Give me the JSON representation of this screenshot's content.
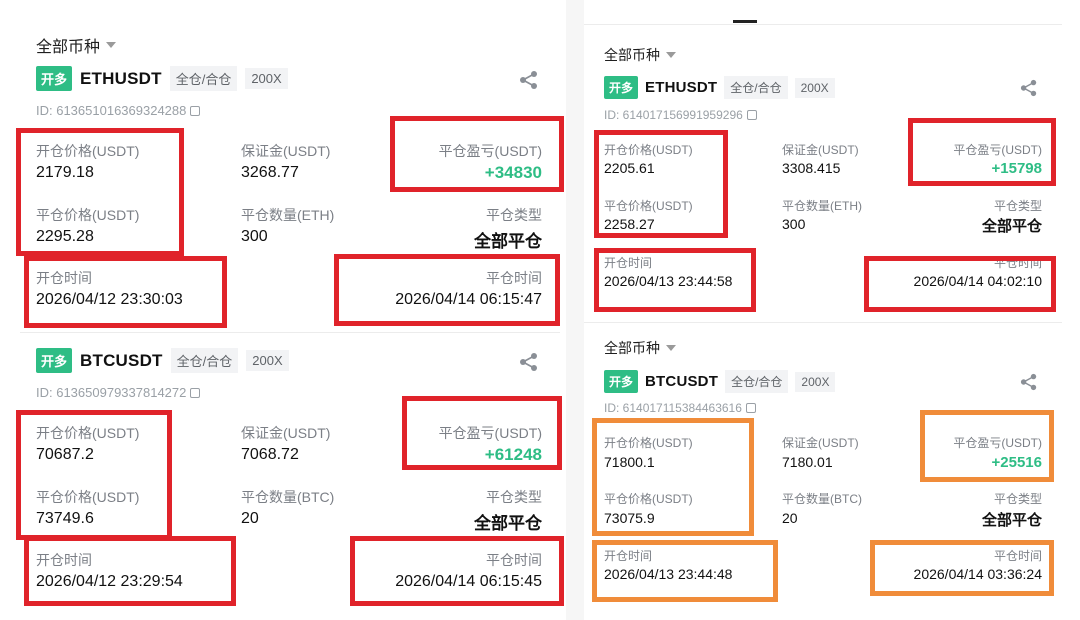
{
  "left": {
    "filter": "全部币种",
    "cards": [
      {
        "side": "开多",
        "symbol": "ETHUSDT",
        "margin_mode": "全仓/合仓",
        "leverage": "200X",
        "id": "ID: 613651016369324288",
        "open_price_label": "开仓价格(USDT)",
        "open_price": "2179.18",
        "margin_label": "保证金(USDT)",
        "margin": "3268.77",
        "pnl_label": "平仓盈亏(USDT)",
        "pnl": "+34830",
        "close_price_label": "平仓价格(USDT)",
        "close_price": "2295.28",
        "close_qty_label": "平仓数量(ETH)",
        "close_qty": "300",
        "close_type_label": "平仓类型",
        "close_type": "全部平仓",
        "open_time_label": "开仓时间",
        "open_time": "2026/04/12 23:30:03",
        "close_time_label": "平仓时间",
        "close_time": "2026/04/14 06:15:47"
      },
      {
        "side": "开多",
        "symbol": "BTCUSDT",
        "margin_mode": "全仓/合仓",
        "leverage": "200X",
        "id": "ID: 613650979337814272",
        "open_price_label": "开仓价格(USDT)",
        "open_price": "70687.2",
        "margin_label": "保证金(USDT)",
        "margin": "7068.72",
        "pnl_label": "平仓盈亏(USDT)",
        "pnl": "+61248",
        "close_price_label": "平仓价格(USDT)",
        "close_price": "73749.6",
        "close_qty_label": "平仓数量(BTC)",
        "close_qty": "20",
        "close_type_label": "平仓类型",
        "close_type": "全部平仓",
        "open_time_label": "开仓时间",
        "open_time": "2026/04/12 23:29:54",
        "close_time_label": "平仓时间",
        "close_time": "2026/04/14 06:15:45"
      }
    ]
  },
  "right": {
    "filter": "全部币种",
    "cards": [
      {
        "side": "开多",
        "symbol": "ETHUSDT",
        "margin_mode": "全仓/合仓",
        "leverage": "200X",
        "id": "ID: 614017156991959296",
        "open_price_label": "开仓价格(USDT)",
        "open_price": "2205.61",
        "margin_label": "保证金(USDT)",
        "margin": "3308.415",
        "pnl_label": "平仓盈亏(USDT)",
        "pnl": "+15798",
        "close_price_label": "平仓价格(USDT)",
        "close_price": "2258.27",
        "close_qty_label": "平仓数量(ETH)",
        "close_qty": "300",
        "close_type_label": "平仓类型",
        "close_type": "全部平仓",
        "open_time_label": "开仓时间",
        "open_time": "2026/04/13 23:44:58",
        "close_time_label": "平仓时间",
        "close_time": "2026/04/14 04:02:10"
      },
      {
        "side": "开多",
        "symbol": "BTCUSDT",
        "margin_mode": "全仓/合仓",
        "leverage": "200X",
        "id": "ID: 614017115384463616",
        "open_price_label": "开仓价格(USDT)",
        "open_price": "71800.1",
        "margin_label": "保证金(USDT)",
        "margin": "7180.01",
        "pnl_label": "平仓盈亏(USDT)",
        "pnl": "+25516",
        "close_price_label": "平仓价格(USDT)",
        "close_price": "73075.9",
        "close_qty_label": "平仓数量(BTC)",
        "close_qty": "20",
        "close_type_label": "平仓类型",
        "close_type": "全部平仓",
        "open_time_label": "开仓时间",
        "open_time": "2026/04/13 23:44:48",
        "close_time_label": "平仓时间",
        "close_time": "2026/04/14 03:36:24"
      }
    ]
  },
  "icons": {
    "share": "share-icon",
    "copy": "copy-icon",
    "caret": "caret-down-icon"
  },
  "colors": {
    "long": "#2ebd85",
    "profit": "#2ebd85",
    "highlight_red": "#e0232a",
    "highlight_orange": "#f08c3a"
  }
}
